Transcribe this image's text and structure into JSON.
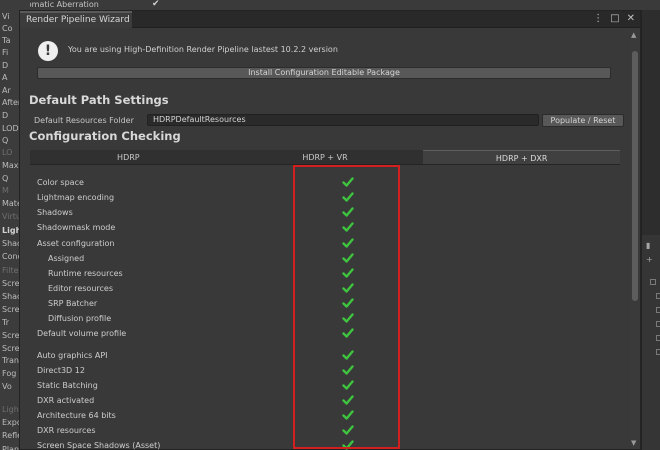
{
  "background_editor": {
    "top_item": "Chromatic Aberration",
    "left_fragments": [
      {
        "text": "Vi",
        "style": ""
      },
      {
        "text": "Co",
        "style": ""
      },
      {
        "text": "Ta",
        "style": ""
      },
      {
        "text": "Fi",
        "style": ""
      },
      {
        "text": "D",
        "style": ""
      },
      {
        "text": "A",
        "style": ""
      },
      {
        "text": "Ar",
        "style": ""
      },
      {
        "text": "After",
        "style": ""
      },
      {
        "text": "D",
        "style": ""
      },
      {
        "text": "LOD",
        "style": ""
      },
      {
        "text": "Q",
        "style": ""
      },
      {
        "text": "LO",
        "style": "dim"
      },
      {
        "text": "Maxi",
        "style": ""
      },
      {
        "text": "Q",
        "style": ""
      },
      {
        "text": "M",
        "style": "dim"
      },
      {
        "text": "Mate",
        "style": ""
      },
      {
        "text": "Virtu",
        "style": "dim"
      },
      {
        "text": "Light",
        "style": "bold"
      },
      {
        "text": "Shac",
        "style": ""
      },
      {
        "text": "Conc",
        "style": ""
      },
      {
        "text": "Filte",
        "style": "dim"
      },
      {
        "text": "Scre",
        "style": ""
      },
      {
        "text": "Shac",
        "style": ""
      },
      {
        "text": "Scre",
        "style": ""
      },
      {
        "text": "Tr",
        "style": ""
      },
      {
        "text": "Scre",
        "style": ""
      },
      {
        "text": "Scre",
        "style": ""
      },
      {
        "text": "Tran",
        "style": ""
      },
      {
        "text": "Fog",
        "style": ""
      },
      {
        "text": "Vo",
        "style": ""
      },
      {
        "text": "Light",
        "style": "dim"
      },
      {
        "text": "Expo",
        "style": ""
      },
      {
        "text": "Refle",
        "style": ""
      },
      {
        "text": "Plana",
        "style": ""
      }
    ]
  },
  "window": {
    "title": "Render Pipeline Wizard",
    "menu_icon": "⋮",
    "maximize_icon": "□",
    "close_icon": "✕"
  },
  "help": {
    "icon_glyph": "!",
    "message": "You are using High-Definition Render Pipeline lastest 10.2.2 version"
  },
  "install_button": "Install Configuration Editable Package",
  "default_path": {
    "heading": "Default Path Settings",
    "label": "Default Resources Folder",
    "value": "HDRPDefaultResources",
    "populate_button": "Populate / Reset"
  },
  "config": {
    "heading": "Configuration Checking",
    "tabs": [
      {
        "label": "HDRP",
        "active": false
      },
      {
        "label": "HDRP + VR",
        "active": false
      },
      {
        "label": "HDRP + DXR",
        "active": true
      }
    ],
    "check_color": "#3ec43e",
    "highlight_color": "#d21f1f",
    "rows": [
      {
        "label": "Color space",
        "indent": 0,
        "status": "ok"
      },
      {
        "label": "Lightmap encoding",
        "indent": 0,
        "status": "ok"
      },
      {
        "label": "Shadows",
        "indent": 0,
        "status": "ok"
      },
      {
        "label": "Shadowmask mode",
        "indent": 0,
        "status": "ok"
      },
      {
        "label": "Asset configuration",
        "indent": 0,
        "status": "ok"
      },
      {
        "label": "Assigned",
        "indent": 1,
        "status": "ok"
      },
      {
        "label": "Runtime resources",
        "indent": 1,
        "status": "ok"
      },
      {
        "label": "Editor resources",
        "indent": 1,
        "status": "ok"
      },
      {
        "label": "SRP Batcher",
        "indent": 1,
        "status": "ok"
      },
      {
        "label": "Diffusion profile",
        "indent": 1,
        "status": "ok"
      },
      {
        "label": "Default volume profile",
        "indent": 0,
        "status": "ok"
      },
      {
        "label": "Auto graphics API",
        "indent": 0,
        "status": "ok"
      },
      {
        "label": "Direct3D 12",
        "indent": 0,
        "status": "ok"
      },
      {
        "label": "Static Batching",
        "indent": 0,
        "status": "ok"
      },
      {
        "label": "DXR activated",
        "indent": 0,
        "status": "ok"
      },
      {
        "label": "Architecture 64 bits",
        "indent": 0,
        "status": "ok"
      },
      {
        "label": "DXR resources",
        "indent": 0,
        "status": "ok"
      },
      {
        "label": "Screen Space Shadows (Asset)",
        "indent": 0,
        "status": "ok"
      }
    ]
  }
}
